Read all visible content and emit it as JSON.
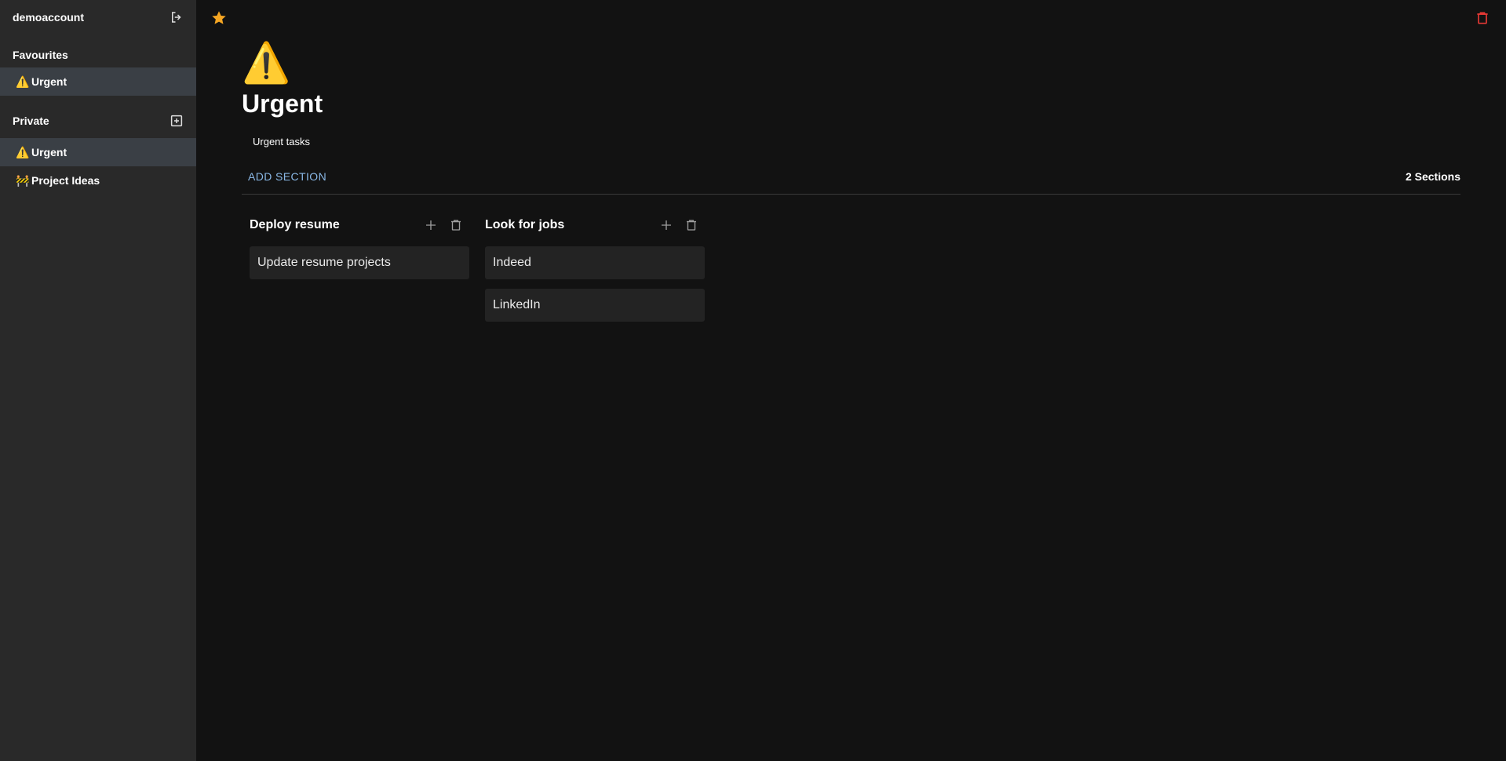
{
  "sidebar": {
    "username": "demoaccount",
    "favourites_title": "Favourites",
    "favourites": [
      {
        "icon": "⚠️",
        "label": "Urgent"
      }
    ],
    "private_title": "Private",
    "private": [
      {
        "icon": "⚠️",
        "label": "Urgent"
      },
      {
        "icon": "🚧",
        "label": "Project Ideas"
      }
    ]
  },
  "page": {
    "icon": "⚠️",
    "title": "Urgent",
    "description": "Urgent tasks",
    "add_section_label": "ADD SECTION",
    "section_count": "2 Sections"
  },
  "sections": [
    {
      "title": "Deploy resume",
      "tasks": [
        "Update resume projects"
      ]
    },
    {
      "title": "Look for jobs",
      "tasks": [
        "Indeed",
        "LinkedIn"
      ]
    }
  ],
  "colors": {
    "favourite_star": "#f5a623",
    "delete_red": "#e53935",
    "link_blue": "#8ab8e6"
  }
}
